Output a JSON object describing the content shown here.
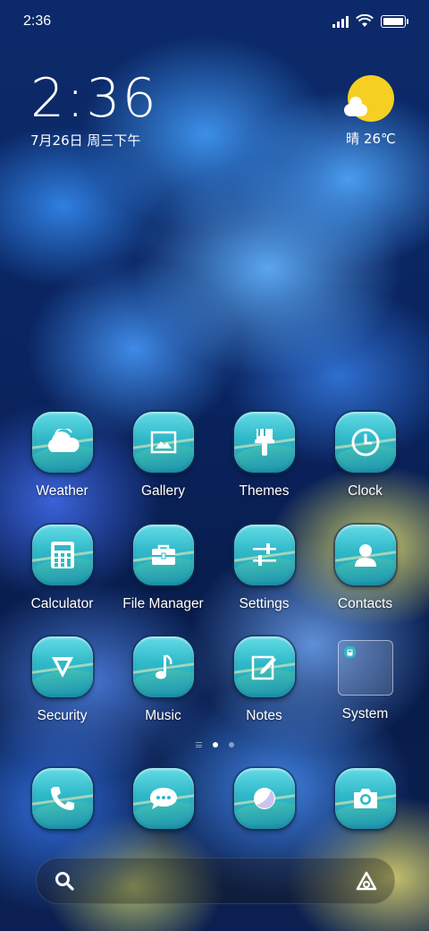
{
  "status_bar": {
    "time": "2:36"
  },
  "clock_widget": {
    "time": "2:36",
    "date": "7月26日 周三下午"
  },
  "weather_widget": {
    "condition": "晴",
    "temperature": "26℃",
    "icon": "sun-cloud-icon",
    "sun_color": "#f5cf22"
  },
  "apps": [
    {
      "label": "Weather",
      "icon": "weather-icon"
    },
    {
      "label": "Gallery",
      "icon": "gallery-icon"
    },
    {
      "label": "Themes",
      "icon": "brush-icon"
    },
    {
      "label": "Clock",
      "icon": "clock-icon"
    },
    {
      "label": "Calculator",
      "icon": "calculator-icon"
    },
    {
      "label": "File Manager",
      "icon": "briefcase-icon"
    },
    {
      "label": "Settings",
      "icon": "sliders-icon"
    },
    {
      "label": "Contacts",
      "icon": "person-icon"
    },
    {
      "label": "Security",
      "icon": "shield-arrow-icon"
    },
    {
      "label": "Music",
      "icon": "music-note-icon"
    },
    {
      "label": "Notes",
      "icon": "pencil-note-icon"
    },
    {
      "label": "System",
      "icon": "folder-icon"
    }
  ],
  "page_indicator": {
    "pages": 3,
    "current": 2
  },
  "dock": [
    {
      "icon": "phone-icon"
    },
    {
      "icon": "message-icon"
    },
    {
      "icon": "browser-icon"
    },
    {
      "icon": "camera-icon"
    }
  ],
  "search_bar": {
    "icon": "search-icon",
    "assistant_icon": "assistant-icon"
  },
  "colors": {
    "icon_teal": "#2fb8c8",
    "wallpaper_blue": "#0c2a6a"
  }
}
